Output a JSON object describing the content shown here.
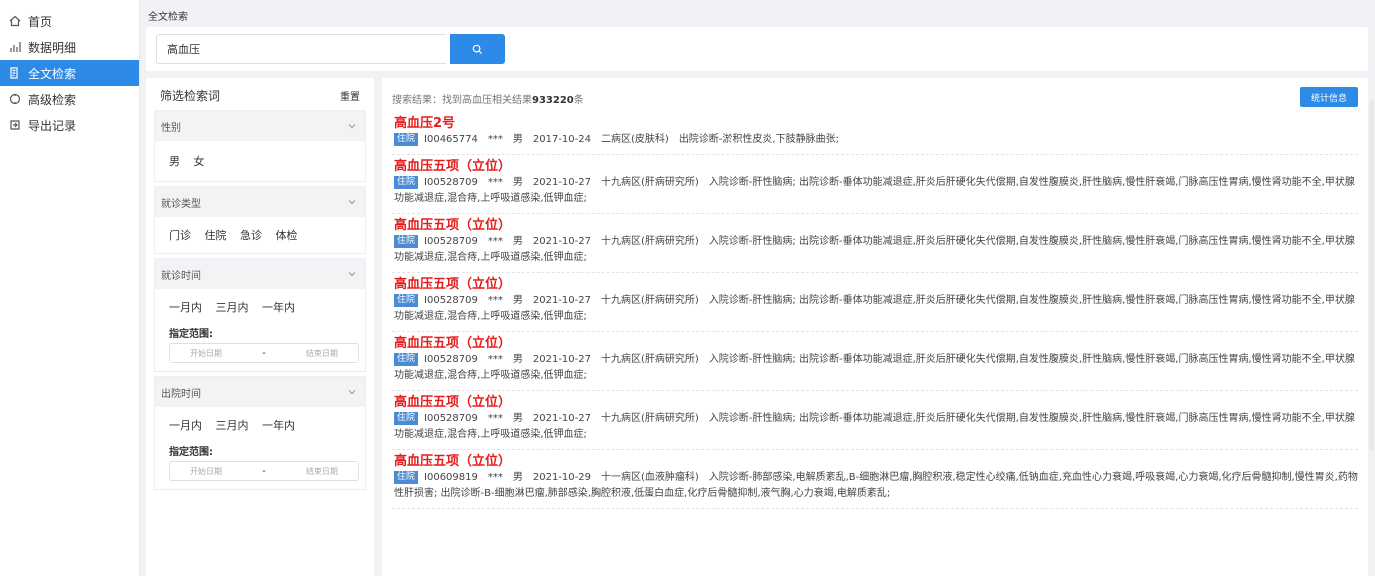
{
  "sidebar": {
    "items": [
      {
        "label": "首页",
        "icon": "home-icon"
      },
      {
        "label": "数据明细",
        "icon": "bar-chart-icon"
      },
      {
        "label": "全文检索",
        "icon": "document-search-icon",
        "active": true
      },
      {
        "label": "高级检索",
        "icon": "advanced-search-icon"
      },
      {
        "label": "导出记录",
        "icon": "export-icon"
      }
    ]
  },
  "breadcrumb": "全文检索",
  "search": {
    "value": "高血压"
  },
  "filter": {
    "title": "筛选检索词",
    "reset_label": "重置",
    "gender": {
      "title": "性别",
      "options": [
        "男",
        "女"
      ]
    },
    "visit_type": {
      "title": "就诊类型",
      "options": [
        "门诊",
        "住院",
        "急诊",
        "体检"
      ]
    },
    "visit_time": {
      "title": "就诊时间",
      "options": [
        "一月内",
        "三月内",
        "一年内"
      ],
      "range_label": "指定范围:",
      "start_placeholder": "开始日期",
      "end_placeholder": "结束日期",
      "separator": "-"
    },
    "discharge_time": {
      "title": "出院时间",
      "options": [
        "一月内",
        "三月内",
        "一年内"
      ],
      "range_label": "指定范围:",
      "start_placeholder": "开始日期",
      "end_placeholder": "结束日期",
      "separator": "-"
    }
  },
  "results": {
    "summary_prefix": "搜索结果：找到高血压相关结果",
    "count": "933220",
    "summary_suffix": "条",
    "stats_button": "统计信息",
    "items": [
      {
        "title": "高血压2号",
        "tag": "住院",
        "id": "I00465774",
        "name": "***",
        "gender": "男",
        "date": "2017-10-24",
        "ward": "二病区(皮肤科)",
        "detail": "出院诊断-淤积性皮炎,下肢静脉曲张;"
      },
      {
        "title": "高血压五项（立位）",
        "tag": "住院",
        "id": "I00528709",
        "name": "***",
        "gender": "男",
        "date": "2021-10-27",
        "ward": "十九病区(肝病研究所)",
        "detail": "入院诊断-肝性脑病; 出院诊断-垂体功能减退症,肝炎后肝硬化失代偿期,自发性腹膜炎,肝性脑病,慢性肝衰竭,门脉高压性胃病,慢性肾功能不全,甲状腺功能减退症,混合痔,上呼吸道感染,低钾血症;"
      },
      {
        "title": "高血压五项（立位）",
        "tag": "住院",
        "id": "I00528709",
        "name": "***",
        "gender": "男",
        "date": "2021-10-27",
        "ward": "十九病区(肝病研究所)",
        "detail": "入院诊断-肝性脑病; 出院诊断-垂体功能减退症,肝炎后肝硬化失代偿期,自发性腹膜炎,肝性脑病,慢性肝衰竭,门脉高压性胃病,慢性肾功能不全,甲状腺功能减退症,混合痔,上呼吸道感染,低钾血症;"
      },
      {
        "title": "高血压五项（立位）",
        "tag": "住院",
        "id": "I00528709",
        "name": "***",
        "gender": "男",
        "date": "2021-10-27",
        "ward": "十九病区(肝病研究所)",
        "detail": "入院诊断-肝性脑病; 出院诊断-垂体功能减退症,肝炎后肝硬化失代偿期,自发性腹膜炎,肝性脑病,慢性肝衰竭,门脉高压性胃病,慢性肾功能不全,甲状腺功能减退症,混合痔,上呼吸道感染,低钾血症;"
      },
      {
        "title": "高血压五项（立位）",
        "tag": "住院",
        "id": "I00528709",
        "name": "***",
        "gender": "男",
        "date": "2021-10-27",
        "ward": "十九病区(肝病研究所)",
        "detail": "入院诊断-肝性脑病; 出院诊断-垂体功能减退症,肝炎后肝硬化失代偿期,自发性腹膜炎,肝性脑病,慢性肝衰竭,门脉高压性胃病,慢性肾功能不全,甲状腺功能减退症,混合痔,上呼吸道感染,低钾血症;"
      },
      {
        "title": "高血压五项（立位）",
        "tag": "住院",
        "id": "I00528709",
        "name": "***",
        "gender": "男",
        "date": "2021-10-27",
        "ward": "十九病区(肝病研究所)",
        "detail": "入院诊断-肝性脑病; 出院诊断-垂体功能减退症,肝炎后肝硬化失代偿期,自发性腹膜炎,肝性脑病,慢性肝衰竭,门脉高压性胃病,慢性肾功能不全,甲状腺功能减退症,混合痔,上呼吸道感染,低钾血症;"
      },
      {
        "title": "高血压五项（立位）",
        "tag": "住院",
        "id": "I00609819",
        "name": "***",
        "gender": "男",
        "date": "2021-10-29",
        "ward": "十一病区(血液肿瘤科)",
        "detail": "入院诊断-肺部感染,电解质紊乱,B-细胞淋巴瘤,胸腔积液,稳定性心绞痛,低钠血症,充血性心力衰竭,呼吸衰竭,心力衰竭,化疗后骨髓抑制,慢性胃炎,药物性肝损害; 出院诊断-B-细胞淋巴瘤,肺部感染,胸腔积液,低蛋白血症,化疗后骨髓抑制,液气胸,心力衰竭,电解质紊乱;"
      }
    ]
  },
  "colors": {
    "accent": "#2d8ae6",
    "title_red": "#e51c1c",
    "tag_blue": "#4a8bd4"
  }
}
